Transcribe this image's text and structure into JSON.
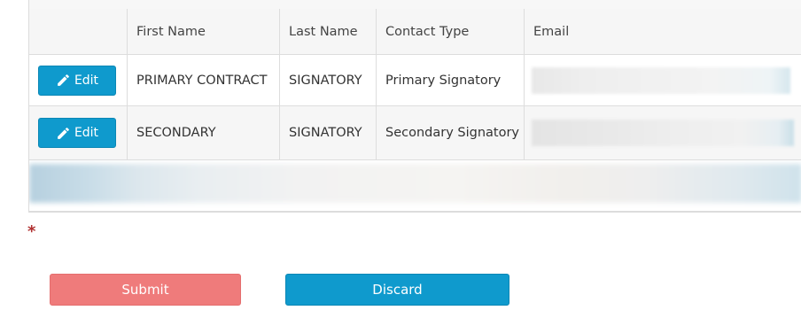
{
  "contacts_table": {
    "columns": [
      "",
      "First Name",
      "Last Name",
      "Contact Type",
      "Email"
    ],
    "rows": [
      {
        "action_label": "Edit",
        "first_name": "PRIMARY CONTRACT",
        "last_name": "SIGNATORY",
        "contact_type": "Primary Signatory",
        "email": ""
      },
      {
        "action_label": "Edit",
        "first_name": "SECONDARY",
        "last_name": "SIGNATORY",
        "contact_type": "Secondary Signatory",
        "email": ""
      }
    ]
  },
  "required_marker": "*",
  "actions": {
    "submit_label": "Submit",
    "discard_label": "Discard"
  },
  "colors": {
    "primary": "#0f9acd",
    "submit": "#ef7b7b",
    "required": "#b03030"
  },
  "icons": {
    "edit": "pencil-icon"
  }
}
